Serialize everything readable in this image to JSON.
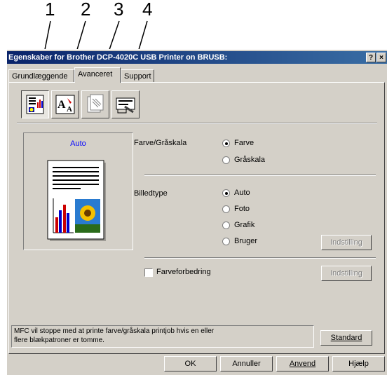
{
  "callouts": [
    "1",
    "2",
    "3",
    "4"
  ],
  "window": {
    "title": "Egenskaber for Brother DCP-4020C USB Printer on BRUSB:",
    "help_button": "?",
    "close_button": "×"
  },
  "tabs": [
    {
      "label": "Grundlæggende",
      "active": false
    },
    {
      "label": "Avanceret",
      "active": true
    },
    {
      "label": "Support",
      "active": false
    }
  ],
  "toolbar_icons": [
    "print-quality-icon",
    "font-icon",
    "copy-icon",
    "device-options-icon"
  ],
  "preview": {
    "label": "Auto"
  },
  "color_section": {
    "label": "Farve/Gråskala",
    "options": [
      {
        "label": "Farve",
        "selected": true
      },
      {
        "label": "Gråskala",
        "selected": false
      }
    ]
  },
  "image_type": {
    "label": "Billedtype",
    "options": [
      {
        "label": "Auto",
        "selected": true
      },
      {
        "label": "Foto",
        "selected": false
      },
      {
        "label": "Grafik",
        "selected": false
      },
      {
        "label": "Bruger",
        "selected": false
      }
    ],
    "settings_button": "Indstilling"
  },
  "color_enhance": {
    "label": "Farveforbedring",
    "checked": false,
    "settings_button": "Indstilling"
  },
  "status_message": "MFC vil stoppe med at printe farve/gråskala printjob hvis en eller flere blækpatroner er tomme.",
  "standard_button": "Standard",
  "footer": {
    "ok": "OK",
    "cancel": "Annuller",
    "apply": "Anvend",
    "help": "Hjælp"
  },
  "colors": {
    "title_gradient_start": "#0a246a",
    "title_gradient_end": "#3a6ea5",
    "dialog_bg": "#d4d0c8",
    "preview_label": "#0000ff"
  }
}
